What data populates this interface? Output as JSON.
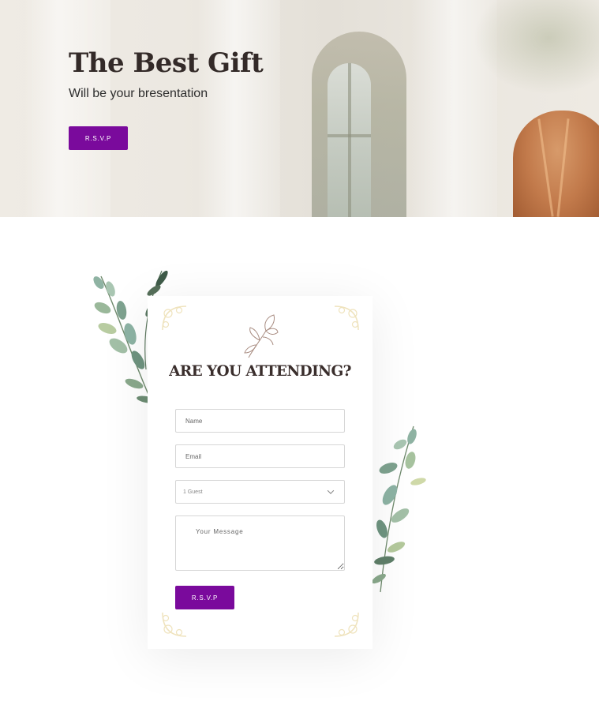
{
  "hero": {
    "title": "The Best Gift",
    "subtitle": "Will be your bresentation",
    "button_label": "R.S.V.P"
  },
  "rsvp_form": {
    "title": "ARE YOU ATTENDING?",
    "name_placeholder": "Name",
    "email_placeholder": "Email",
    "guests_selected": "1 Guest",
    "message_placeholder": "Your Message",
    "submit_label": "R.S.V.P"
  },
  "colors": {
    "accent": "#7a0a9c",
    "title_text": "#3a2e2c"
  },
  "icons": {
    "decorative_flower": "flower-sketch-icon",
    "corner_ornament": "floral-corner-ornament",
    "select_chevron": "chevron-down-icon"
  }
}
